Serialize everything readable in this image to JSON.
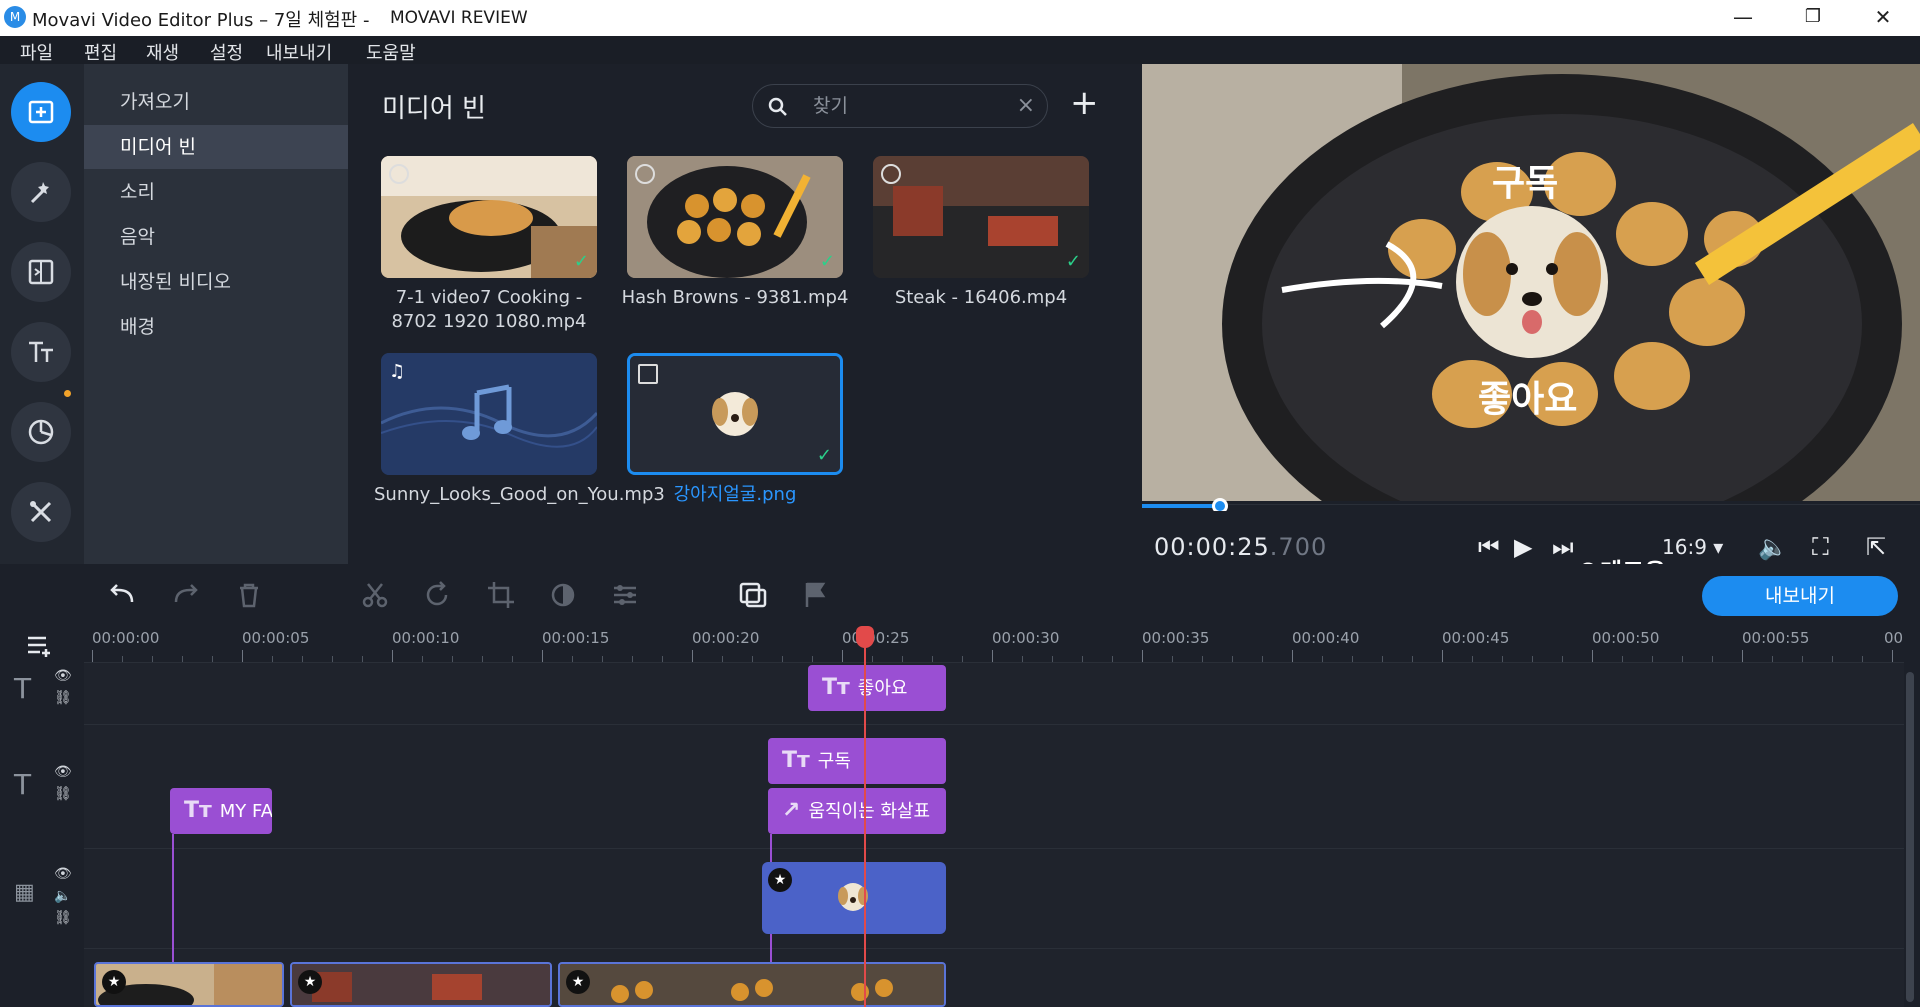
{
  "window": {
    "title": "Movavi Video Editor Plus – 7일 체험판 -",
    "title_suffix": "MOVAVI REVIEW",
    "minimize": "—",
    "restore": "❐",
    "close": "✕"
  },
  "menu": [
    "파일",
    "편집",
    "재생",
    "설정",
    "내보내기",
    "도움말"
  ],
  "sidebar_icons": [
    "import-icon",
    "magic-wand-icon",
    "transitions-icon",
    "titles-icon",
    "stickers-icon",
    "tools-icon"
  ],
  "categories": [
    "가져오기",
    "미디어 빈",
    "소리",
    "음악",
    "내장된 비디오",
    "배경"
  ],
  "media_bin": {
    "heading": "미디어 빈",
    "search_placeholder": "찾기",
    "items": [
      {
        "label": "7-1 video7 Cooking - 8702 1920 1080.mp4",
        "kind": "video"
      },
      {
        "label": "Hash Browns - 9381.mp4",
        "kind": "video"
      },
      {
        "label": "Steak - 16406.mp4",
        "kind": "video"
      },
      {
        "label": "Sunny_Looks_Good_on_You.mp3",
        "kind": "audio"
      },
      {
        "label": "강아지얼굴.png",
        "kind": "image"
      }
    ]
  },
  "preview": {
    "overlay_top": "구독",
    "overlay_bottom": "좋아요",
    "timecode": "00:00:25",
    "timecode_ms": ".700",
    "progress_fraction": 0.1,
    "aspect": "16:9"
  },
  "watermark": "©테크유",
  "export_button": "내보내기",
  "ruler": [
    "00:00:00",
    "00:00:05",
    "00:00:10",
    "00:00:15",
    "00:00:20",
    "00:00:25",
    "00:00:30",
    "00:00:35",
    "00:00:40",
    "00:00:45",
    "00:00:50",
    "00:00:55",
    "00"
  ],
  "clips": {
    "title_like": "좋아요",
    "title_subscribe": "구독",
    "title_arrow": "움직이는 화살표",
    "title_myfav": "MY FA"
  },
  "colors": {
    "accent": "#1c8cf0",
    "title_clip": "#9a4fd3",
    "image_clip": "#4b62c8",
    "playhead": "#e24a4a"
  }
}
